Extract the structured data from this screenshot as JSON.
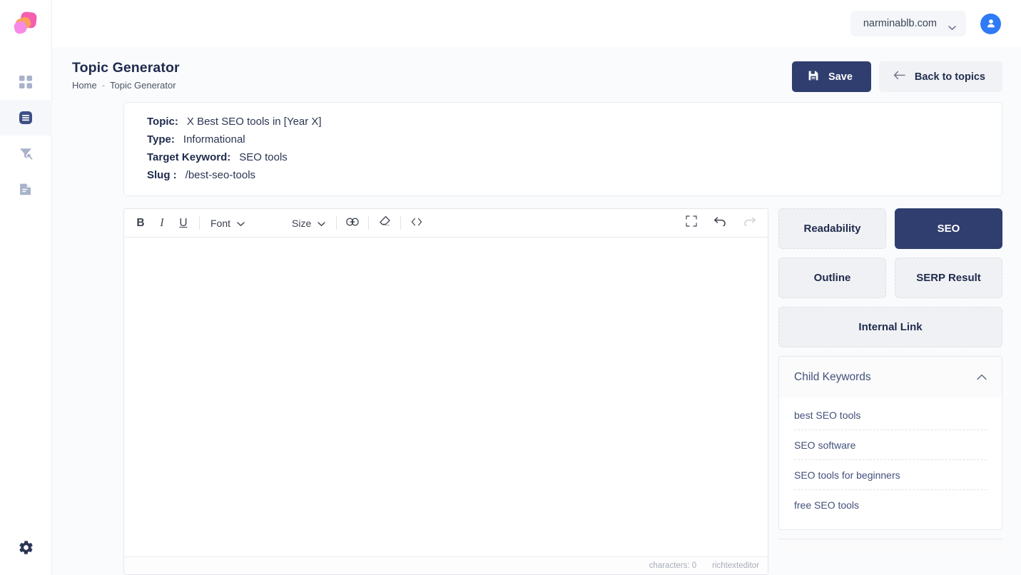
{
  "sidebar": {
    "logo_name": "app-logo",
    "items": [
      {
        "name": "dashboard",
        "icon": "grid-icon"
      },
      {
        "name": "content",
        "icon": "article-icon",
        "active": true
      },
      {
        "name": "keyword-research",
        "icon": "funnel-search-icon"
      },
      {
        "name": "reports",
        "icon": "document-icon"
      }
    ],
    "bottom": {
      "name": "settings",
      "icon": "gear-icon"
    }
  },
  "topbar": {
    "domain": "narminablb.com",
    "domain_chevron": "chevron-down-icon",
    "avatar": "user-avatar-icon"
  },
  "header": {
    "title": "Topic Generator",
    "breadcrumb": {
      "home": "Home",
      "separator": "-",
      "current": "Topic Generator"
    },
    "save_label": "Save",
    "save_icon": "save-floppy-icon",
    "back_label": "Back to topics",
    "back_icon": "arrow-left-icon"
  },
  "info": {
    "topic_label": "Topic:",
    "topic_value": "X Best SEO tools in [Year X]",
    "type_label": "Type:",
    "type_value": "Informational",
    "keyword_label": "Target Keyword:",
    "keyword_value": "SEO tools",
    "slug_label": "Slug :",
    "slug_value": "/best-seo-tools"
  },
  "editor": {
    "toolbar": {
      "bold": "B",
      "italic": "I",
      "underline": "U",
      "font_label": "Font",
      "size_label": "Size",
      "link_icon": "link-icon",
      "eraser_icon": "eraser-icon",
      "code_icon": "code-view-icon",
      "fullscreen_icon": "fullscreen-icon",
      "undo_icon": "undo-icon",
      "redo_icon": "redo-icon"
    },
    "body_text": "",
    "footer": {
      "characters": "characters: 0",
      "brand": "richtexteditor"
    }
  },
  "rail": {
    "tabs": [
      {
        "label": "Readability",
        "active": false
      },
      {
        "label": "SEO",
        "active": true
      },
      {
        "label": "Outline",
        "active": false
      },
      {
        "label": "SERP Result",
        "active": false
      },
      {
        "label": "Internal Link",
        "active": false,
        "wide": true
      }
    ],
    "child_keywords": {
      "title": "Child Keywords",
      "collapse_icon": "chevron-up-icon",
      "items": [
        "best SEO tools",
        "SEO software",
        "SEO tools for beginners",
        "free SEO tools"
      ]
    }
  },
  "colors": {
    "accent_navy": "#2f3e6e",
    "page_bg": "#fafbfc",
    "text_dark": "#1f2b4d",
    "link_blue": "#43507a"
  }
}
